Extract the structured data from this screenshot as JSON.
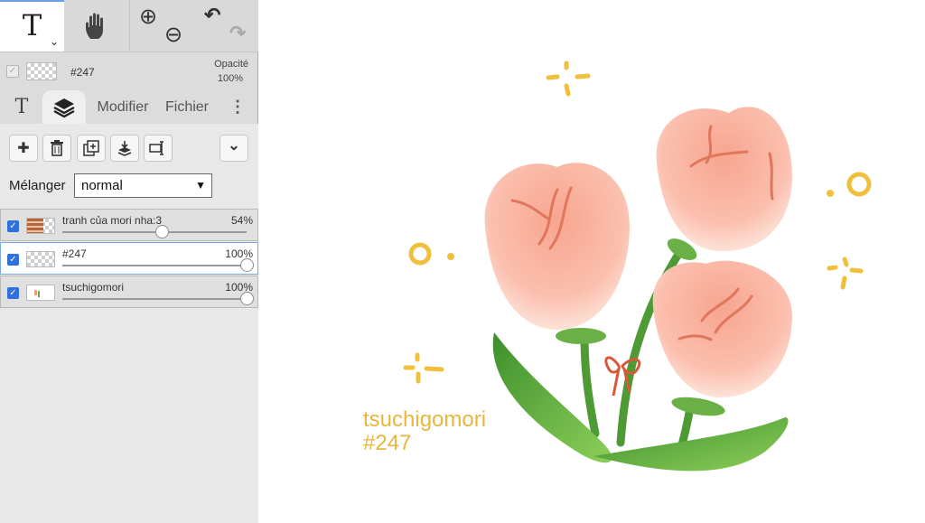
{
  "toolbar": {
    "text_tool": "T",
    "text_tool_chevron": "⌄",
    "hand_tool": "✋",
    "zoom_in": "⊕",
    "zoom_out": "⊖",
    "undo": "↶",
    "redo": "↷"
  },
  "layer_info": {
    "name": "#247",
    "opacity_label": "Opacité",
    "opacity_value": "100%",
    "check": "✓"
  },
  "tabs": {
    "text": "T",
    "layers_icon": "layers-icon",
    "modifier": "Modifier",
    "file": "Fichier",
    "more": "⋮"
  },
  "layer_buttons": {
    "add": "✚",
    "delete": "trash-icon",
    "duplicate": "duplicate-icon",
    "merge_down": "merge-down-icon",
    "transform": "transform-icon",
    "expand": "⌄"
  },
  "blend": {
    "label": "Mélanger",
    "value": "normal",
    "caret": "▼"
  },
  "layers": [
    {
      "name": "tranh của mori nha:3",
      "opacity": "54%",
      "opacity_value": 0.54,
      "visible": true,
      "selected": false
    },
    {
      "name": "#247",
      "opacity": "100%",
      "opacity_value": 1.0,
      "visible": true,
      "selected": true
    },
    {
      "name": "tsuchigomori",
      "opacity": "100%",
      "opacity_value": 1.0,
      "visible": true,
      "selected": false
    }
  ],
  "canvas": {
    "caption_line1": "tsuchigomori",
    "caption_line2": "#247"
  },
  "colors": {
    "accent": "#2f6fde",
    "caption": "#e8b63c",
    "petal": "#f6a994",
    "leaf": "#5aa53a",
    "sparkle": "#f0c03c"
  }
}
